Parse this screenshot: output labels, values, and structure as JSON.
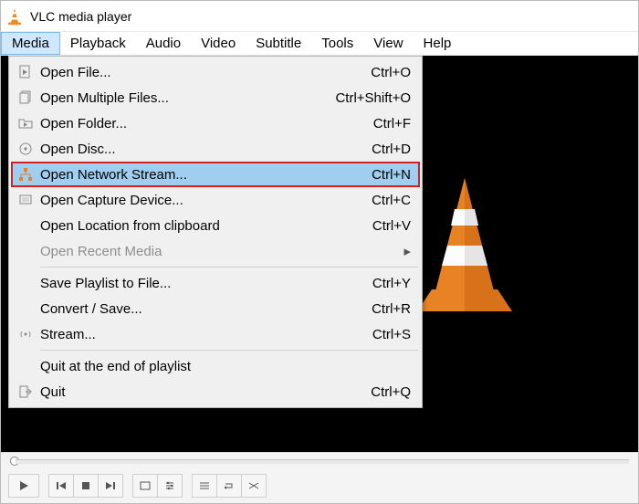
{
  "window": {
    "title": "VLC media player"
  },
  "menubar": {
    "items": [
      "Media",
      "Playback",
      "Audio",
      "Video",
      "Subtitle",
      "Tools",
      "View",
      "Help"
    ],
    "openIndex": 0
  },
  "media_menu": {
    "items": [
      {
        "icon": "file-play-icon",
        "label": "Open File...",
        "shortcut": "Ctrl+O"
      },
      {
        "icon": "files-icon",
        "label": "Open Multiple Files...",
        "shortcut": "Ctrl+Shift+O"
      },
      {
        "icon": "folder-play-icon",
        "label": "Open Folder...",
        "shortcut": "Ctrl+F"
      },
      {
        "icon": "disc-icon",
        "label": "Open Disc...",
        "shortcut": "Ctrl+D"
      },
      {
        "icon": "network-icon",
        "label": "Open Network Stream...",
        "shortcut": "Ctrl+N",
        "highlight": true
      },
      {
        "icon": "capture-icon",
        "label": "Open Capture Device...",
        "shortcut": "Ctrl+C"
      },
      {
        "icon": "",
        "label": "Open Location from clipboard",
        "shortcut": "Ctrl+V"
      },
      {
        "icon": "",
        "label": "Open Recent Media",
        "shortcut": "",
        "submenu": true,
        "disabled": true
      },
      {
        "sep": true
      },
      {
        "icon": "",
        "label": "Save Playlist to File...",
        "shortcut": "Ctrl+Y"
      },
      {
        "icon": "",
        "label": "Convert / Save...",
        "shortcut": "Ctrl+R"
      },
      {
        "icon": "stream-icon",
        "label": "Stream...",
        "shortcut": "Ctrl+S"
      },
      {
        "sep": true
      },
      {
        "icon": "",
        "label": "Quit at the end of playlist",
        "shortcut": ""
      },
      {
        "icon": "quit-icon",
        "label": "Quit",
        "shortcut": "Ctrl+Q"
      }
    ]
  }
}
